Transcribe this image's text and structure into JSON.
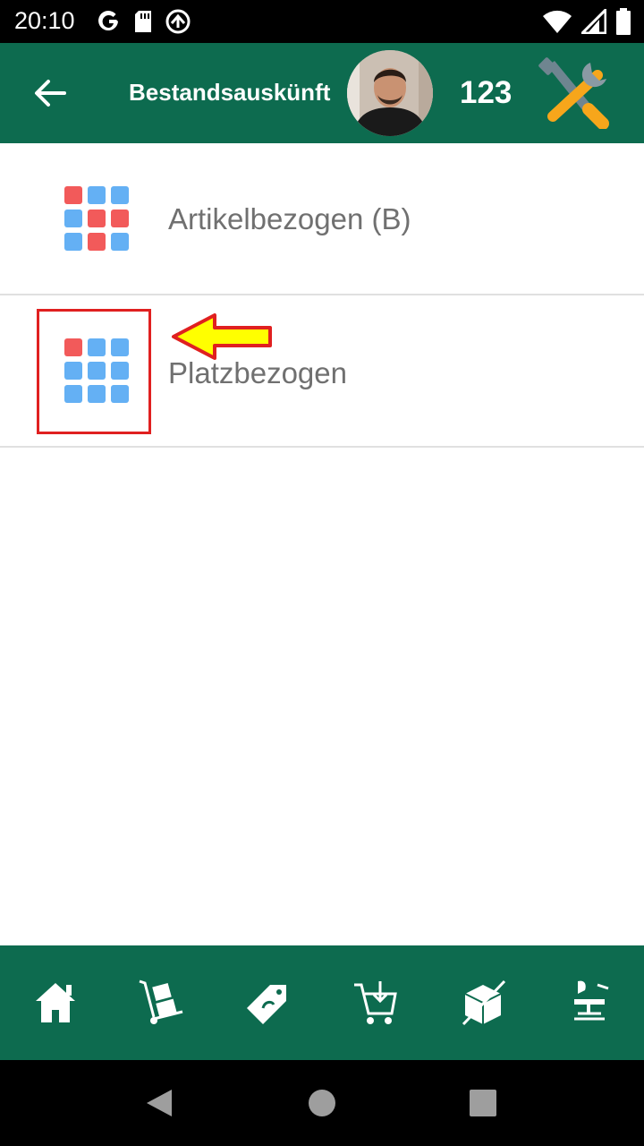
{
  "status_bar": {
    "time": "20:10",
    "left_icons": [
      "google-icon",
      "sd-card-icon",
      "sync-icon"
    ],
    "right_icons": [
      "wifi-icon",
      "signal-icon",
      "battery-icon"
    ]
  },
  "app_bar": {
    "title": "Bestandsauskünft",
    "user_code": "123",
    "back_icon": "arrow-left-icon",
    "tools_icon": "tools-icon"
  },
  "list": {
    "items": [
      {
        "label": "Artikelbezogen (B)",
        "icon": "grid-icon"
      },
      {
        "label": "Platzbezogen",
        "icon": "grid-icon"
      }
    ]
  },
  "colors": {
    "primary": "#0d6b4f",
    "grid_red": "#f25a5a",
    "grid_blue": "#64b0f4",
    "highlight": "#e02020",
    "arrow_fill": "#ffff00"
  },
  "bottom_nav": {
    "items": [
      "home-icon",
      "hand-truck-icon",
      "price-tag-icon",
      "cart-download-icon",
      "box-crossed-icon",
      "office-chair-icon"
    ]
  },
  "system_nav": [
    "back-triangle-icon",
    "home-circle-icon",
    "recents-square-icon"
  ]
}
